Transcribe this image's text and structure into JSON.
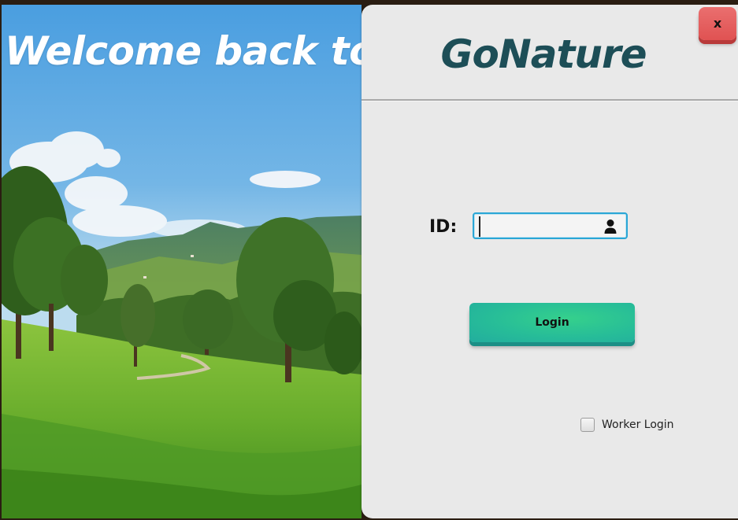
{
  "hero": {
    "welcome_text": "Welcome back to",
    "image": "green-hills-landscape"
  },
  "panel": {
    "brand": "GoNature",
    "close_label": "x",
    "id_label": "ID:",
    "id_value": "",
    "id_icon": "user-icon",
    "login_label": "Login",
    "worker_login_label": "Worker Login",
    "worker_login_checked": false
  },
  "colors": {
    "brand": "#1d4e57",
    "close_button": "#e05252",
    "login_button": "#27bd98",
    "field_focus_border": "#2aa6d6",
    "panel_bg": "#e9e9e9"
  }
}
